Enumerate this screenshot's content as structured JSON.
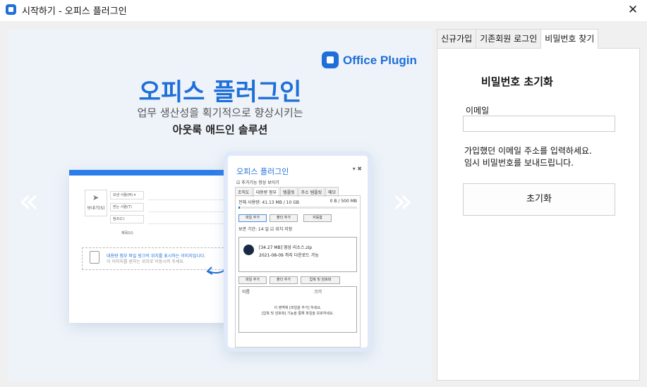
{
  "window": {
    "title": "시작하기 - 오피스 플러그인",
    "close_glyph": "✕"
  },
  "promo": {
    "logo_text": "Office Plugin",
    "title": "오피스 플러그인",
    "subtitle_line1": "업무 생산성을 획기적으로 향상시키는",
    "subtitle_line2": "아웃룩 애드인 솔루션",
    "prev_arrow": "«",
    "next_arrow": "»",
    "mail_mock": {
      "send_label": "보내기(S)",
      "from_label": "보낸 사람(M) ▾",
      "to_label": "받는 사람(T)",
      "cc_label": "참조(C)",
      "subject_label": "제목(U)",
      "drop_line1": "대용량 첨부 파일 링크의 위치를 표시하는 이미지입니다.",
      "drop_line2": "이 이미지를 원하는 위치로 이동시켜 주세요."
    },
    "plugin_mock": {
      "title": "오피스 플러그인",
      "controls": "▾ ✖",
      "checkbox_label": "추가기능 항상 보이기",
      "tabs": [
        "조직도",
        "대용량 첨부",
        "템플릿",
        "주소 템플릿",
        "메모"
      ],
      "active_tab": 1,
      "usage_label": "전체 사용량: 41.13 MB / 10 GB",
      "usage_right": "0 B / 500 MB",
      "usage_fraction": 0.004,
      "btn_add_file": "파일 추가",
      "btn_add_folder": "폴더 추가",
      "btn_vault": "자동함",
      "period_label": "보관 기간:  14  일    ☑ 위치 지정",
      "file_line1": "[34.27 MB]  영상 리소스.zip",
      "file_line2": "2021-08-09 까지 다운로드 가능",
      "btn_add_file2": "파일 추가",
      "btn_add_folder2": "폴더 추가",
      "btn_zip": "압축 및 암호화",
      "list_col1": "이름",
      "list_col2": "크기",
      "list_empty1": "이 영역에 [파일을 추가] 하세요.",
      "list_empty2": "[압축 및 암호화] 기능을 통해 파일을 보호하세요."
    }
  },
  "tabs": [
    {
      "label": "신규가입",
      "active": false
    },
    {
      "label": "기존회원 로그인",
      "active": false
    },
    {
      "label": "비밀번호 찾기",
      "active": true
    }
  ],
  "form": {
    "title": "비밀번호 초기화",
    "email_label": "이메일",
    "email_value": "",
    "help_line1": "가입했던 이메일 주소를 입력하세요.",
    "help_line2": "임시 비밀번호를 보내드립니다.",
    "submit_label": "초기화"
  }
}
